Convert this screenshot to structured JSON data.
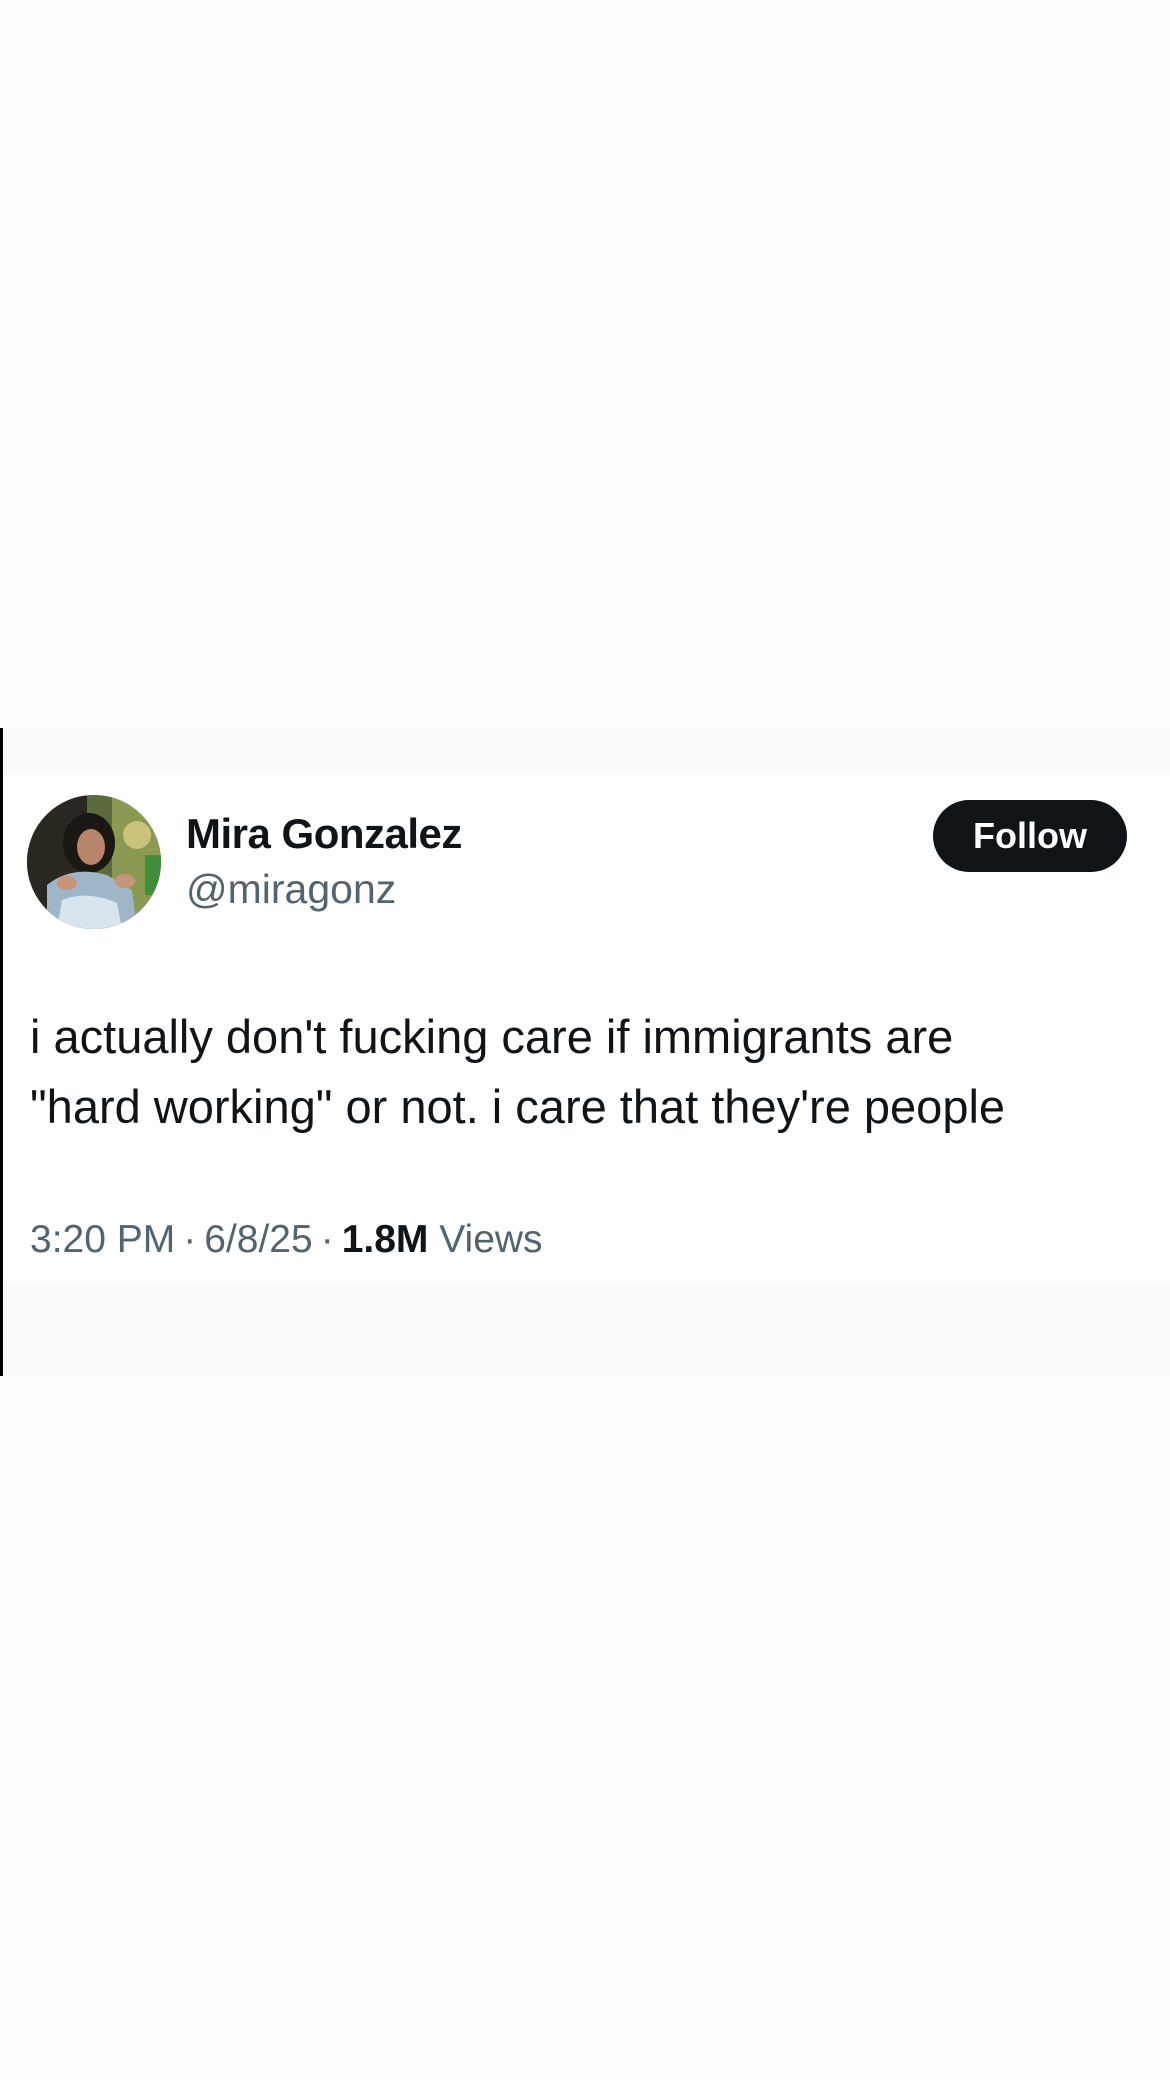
{
  "tweet": {
    "author": {
      "display_name": "Mira Gonzalez",
      "handle": "@miragonz"
    },
    "follow_label": "Follow",
    "text": "i actually don't fucking care if immigrants are\n\"hard working\" or not. i care that they're people",
    "time": "3:20 PM",
    "separator": "·",
    "date": "6/8/25",
    "views_count": "1.8M",
    "views_label": "Views"
  },
  "colors": {
    "primary_text": "#0f1419",
    "secondary_text": "#536471",
    "follow_button_bg": "#0f1419",
    "follow_button_text": "#ffffff"
  }
}
